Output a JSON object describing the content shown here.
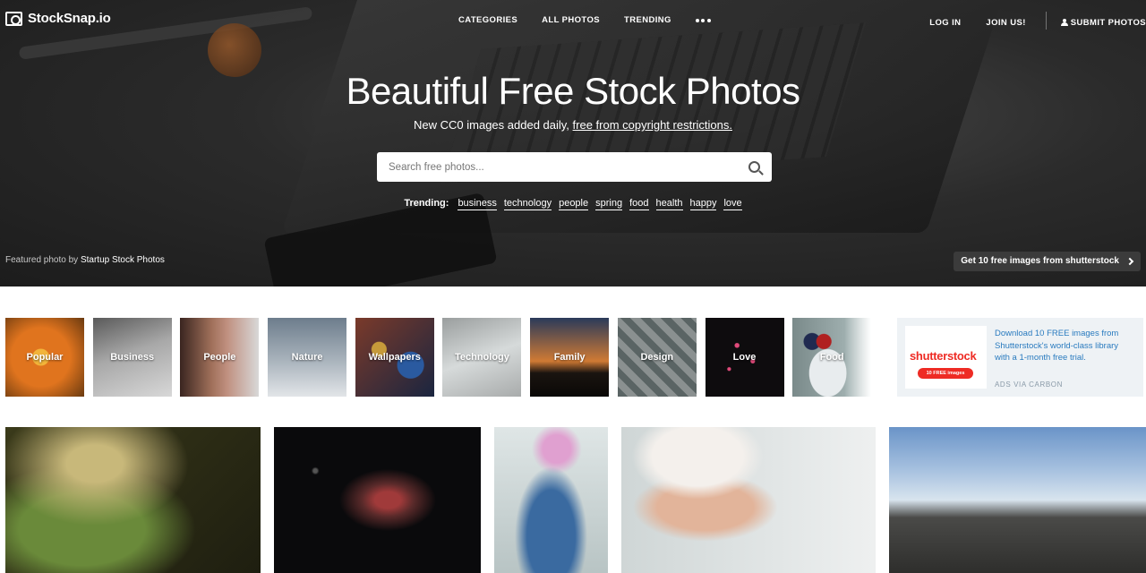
{
  "nav": {
    "logo": "StockSnap.io",
    "links": [
      "CATEGORIES",
      "ALL PHOTOS",
      "TRENDING"
    ],
    "login": "LOG IN",
    "join": "JOIN US!",
    "submit": "SUBMIT PHOTOS"
  },
  "hero": {
    "title": "Beautiful Free Stock Photos",
    "subtitle_prefix": "New CC0 images added daily, ",
    "subtitle_link": "free from copyright restrictions.",
    "search_placeholder": "Search free photos...",
    "trending_label": "Trending:",
    "trending_tags": [
      "business",
      "technology",
      "people",
      "spring",
      "food",
      "health",
      "happy",
      "love"
    ],
    "featured_prefix": "Featured photo by",
    "featured_author": "Startup Stock Photos",
    "promo": "Get 10 free images from shutterstock"
  },
  "categories": [
    {
      "label": "Popular",
      "color": "#c5641a"
    },
    {
      "label": "Business",
      "color": "#9a9a9a"
    },
    {
      "label": "People",
      "color": "#8a5a4a"
    },
    {
      "label": "Nature",
      "color": "#8d9aa6"
    },
    {
      "label": "Wallpapers",
      "color": "#3b4a6a"
    },
    {
      "label": "Technology",
      "color": "#b8bcbc"
    },
    {
      "label": "Family",
      "color": "#c06a2e"
    },
    {
      "label": "Design",
      "color": "#6a7070"
    },
    {
      "label": "Love",
      "color": "#111111"
    },
    {
      "label": "Food",
      "color": "#8a8a8a"
    }
  ],
  "ad": {
    "logo": "shutterstock",
    "pill": "10 FREE images",
    "text": "Download 10 FREE images from Shutterstock's world-class library with a 1-month free trial.",
    "via": "ADS VIA CARBON"
  },
  "icons": [
    "camera-logo-icon",
    "more-dots-icon",
    "user-icon",
    "search-icon",
    "chevron-right-icon"
  ]
}
